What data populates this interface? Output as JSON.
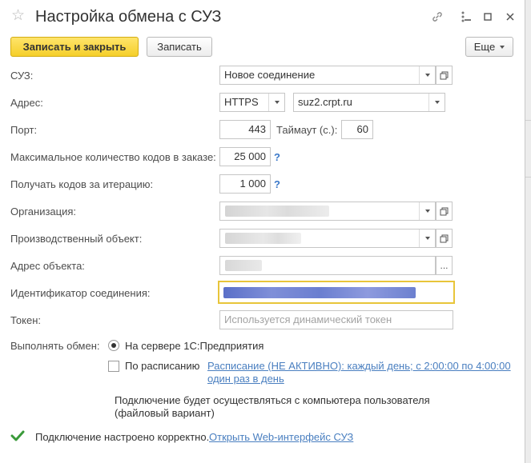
{
  "window": {
    "title": "Настройка обмена с СУЗ",
    "icons": [
      "star-icon",
      "link-icon",
      "more-icon",
      "minimize-icon",
      "maximize-icon",
      "close-icon"
    ]
  },
  "toolbar": {
    "save_close_label": "Записать и закрыть",
    "save_label": "Записать",
    "more_label": "Еще"
  },
  "form": {
    "suz": {
      "label": "СУЗ:",
      "value": "Новое соединение"
    },
    "address": {
      "label": "Адрес:",
      "protocol": "HTTPS",
      "host": "suz2.crpt.ru"
    },
    "port": {
      "label": "Порт:",
      "value": "443"
    },
    "timeout": {
      "label": "Таймаут (с.):",
      "value": "60"
    },
    "max_codes": {
      "label": "Максимальное количество кодов в заказе:",
      "value": "25 000",
      "help": "?"
    },
    "per_iteration": {
      "label": "Получать кодов за итерацию:",
      "value": "1 000",
      "help": "?"
    },
    "organization": {
      "label": "Организация:"
    },
    "production_object": {
      "label": "Производственный объект:"
    },
    "object_address": {
      "label": "Адрес объекта:",
      "button": "..."
    },
    "connection_id": {
      "label": "Идентификатор соединения:"
    },
    "token": {
      "label": "Токен:",
      "placeholder": "Используется динамический токен"
    },
    "exchange": {
      "label": "Выполнять обмен:",
      "option_server": "На сервере 1С:Предприятия",
      "option_server_selected": true,
      "option_schedule": "По расписанию",
      "option_schedule_checked": false,
      "schedule_link_line1": "Расписание (НЕ АКТИВНО): каждый день; с 2:00:00 по 4:00:00",
      "schedule_link_line2": "один раз в день"
    },
    "note_line1": "Подключение будет осуществляться с компьютера пользователя",
    "note_line2": "(файловый вариант)"
  },
  "status": {
    "text": "Подключение настроено корректно.",
    "link": "Открыть Web-интерфейс СУЗ"
  },
  "colors": {
    "accent_yellow": "#f5cf2a",
    "focus_border": "#e8c53a",
    "link_blue": "#4a7fc0",
    "check_green": "#3a9a3a"
  }
}
